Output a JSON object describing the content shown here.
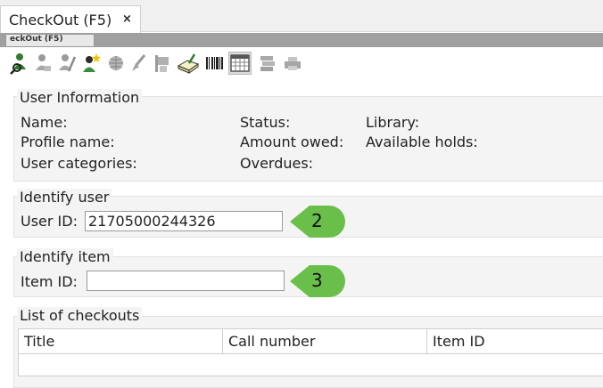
{
  "tabs": {
    "main_title": "CheckOut (F5)",
    "close_glyph": "×",
    "sub_title": "eckOut (F5)"
  },
  "toolbar": {
    "buttons": [
      {
        "icon": "user-search-icon",
        "enabled": true
      },
      {
        "icon": "user-edit-icon",
        "enabled": false
      },
      {
        "icon": "user-modify-icon",
        "enabled": false
      },
      {
        "icon": "user-new-icon",
        "enabled": true
      },
      {
        "icon": "globe-icon",
        "enabled": false
      },
      {
        "icon": "brush-icon",
        "enabled": false
      },
      {
        "icon": "flag-icon",
        "enabled": false
      },
      {
        "icon": "book-edit-icon",
        "enabled": true
      },
      {
        "icon": "barcode-icon",
        "enabled": true
      },
      {
        "icon": "calendar-icon",
        "enabled": true
      },
      {
        "icon": "stack-icon",
        "enabled": false
      },
      {
        "icon": "printer-icon",
        "enabled": false
      }
    ]
  },
  "user_info": {
    "legend": "User Information",
    "name_label": "Name:",
    "profile_label": "Profile name:",
    "categories_label": "User categories:",
    "status_label": "Status:",
    "amount_label": "Amount owed:",
    "overdues_label": "Overdues:",
    "library_label": "Library:",
    "holds_label": "Available holds:"
  },
  "identify_user": {
    "legend": "Identify user",
    "user_id_label": "User ID:",
    "user_id_value": "21705000244326",
    "callout": "2"
  },
  "identify_item": {
    "legend": "Identify item",
    "item_id_label": "Item ID:",
    "item_id_value": "",
    "callout": "3"
  },
  "checkouts": {
    "legend": "List of checkouts",
    "columns": [
      "Title",
      "Call number",
      "Item ID"
    ]
  },
  "colors": {
    "callout_green": "#6abf4b",
    "panel_bg": "#f4f4f4"
  }
}
